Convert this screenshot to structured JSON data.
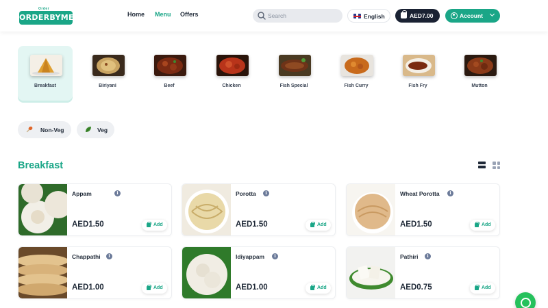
{
  "header": {
    "logo_sub": "Order",
    "logo_main": "ORDERBYME",
    "nav": [
      "Home",
      "Menu",
      "Offers"
    ],
    "active_nav": "Menu",
    "search_placeholder": "Search",
    "language": "English",
    "cart_total": "AED7.00",
    "account_label": "Account"
  },
  "categories": [
    {
      "label": "Breakfast",
      "icon": "breakfast-dosa",
      "active": true
    },
    {
      "label": "Biriyani",
      "icon": "biriyani"
    },
    {
      "label": "Beef",
      "icon": "beef"
    },
    {
      "label": "Chicken",
      "icon": "chicken"
    },
    {
      "label": "Fish Special",
      "icon": "fish-special"
    },
    {
      "label": "Fish Curry",
      "icon": "fish-curry"
    },
    {
      "label": "Fish Fry",
      "icon": "fish-fry"
    },
    {
      "label": "Mutton",
      "icon": "mutton"
    }
  ],
  "filters": [
    {
      "label": "Non-Veg",
      "icon": "drumstick-icon"
    },
    {
      "label": "Veg",
      "icon": "leaf-icon"
    }
  ],
  "section": {
    "title": "Breakfast"
  },
  "items": [
    {
      "name": "Appam",
      "price": "AED1.50",
      "add_label": "Add"
    },
    {
      "name": "Porotta",
      "price": "AED1.50",
      "add_label": "Add"
    },
    {
      "name": "Wheat Porotta",
      "price": "AED1.50",
      "add_label": "Add"
    },
    {
      "name": "Chappathi",
      "price": "AED1.00",
      "add_label": "Add"
    },
    {
      "name": "Idiyappam",
      "price": "AED1.00",
      "add_label": "Add"
    },
    {
      "name": "Pathiri",
      "price": "AED0.75",
      "add_label": "Add"
    }
  ],
  "colors": {
    "accent": "#1aa687",
    "dark": "#1a2233",
    "whatsapp": "#25c15c"
  }
}
